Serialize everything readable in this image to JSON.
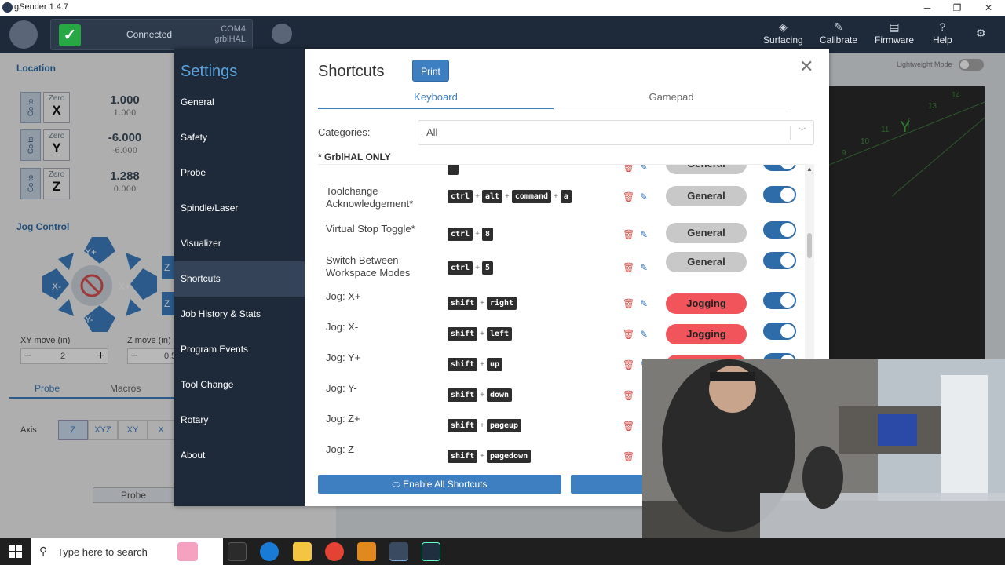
{
  "window": {
    "title": "gSender 1.4.7"
  },
  "topbar": {
    "connection": {
      "status": "Connected",
      "port": "COM4",
      "firmware": "grblHAL"
    },
    "nav": [
      {
        "label": "Surfacing",
        "icon": "surfacing-icon"
      },
      {
        "label": "Calibrate",
        "icon": "calibrate-icon"
      },
      {
        "label": "Firmware",
        "icon": "firmware-icon"
      },
      {
        "label": "Help",
        "icon": "help-icon"
      }
    ]
  },
  "location": {
    "title": "Location",
    "goto_label": "Go to",
    "zero_label": "Zero",
    "axes": [
      {
        "axis": "X",
        "value": "1.000",
        "machine": "1.000"
      },
      {
        "axis": "Y",
        "value": "-6.000",
        "machine": "-6.000"
      },
      {
        "axis": "Z",
        "value": "1.288",
        "machine": "0.000"
      }
    ]
  },
  "jog": {
    "title": "Jog Control",
    "xy_label": "XY move (in)",
    "xy_value": "2",
    "z_label": "Z move (in)",
    "z_value": "0.5",
    "labels": {
      "yplus": "Y+",
      "yminus": "Y-",
      "xplus": "X+",
      "xminus": "X-",
      "z": "Z"
    }
  },
  "bottom_tabs": {
    "probe": "Probe",
    "macros": "Macros"
  },
  "probe_panel": {
    "axis_label": "Axis",
    "axes": [
      "Z",
      "XYZ",
      "XY",
      "X"
    ],
    "probe_button": "Probe"
  },
  "lightweight": {
    "label": "Lightweight Mode"
  },
  "settings": {
    "title": "Settings",
    "menu": [
      "General",
      "Safety",
      "Probe",
      "Spindle/Laser",
      "Visualizer",
      "Shortcuts",
      "Job History & Stats",
      "Program Events",
      "Tool Change",
      "Rotary",
      "About"
    ],
    "active": "Shortcuts"
  },
  "shortcuts": {
    "title": "Shortcuts",
    "print_label": "Print",
    "tabs": {
      "keyboard": "Keyboard",
      "gamepad": "Gamepad"
    },
    "categories_label": "Categories:",
    "categories_value": "All",
    "grbl_note": "* GrblHAL ONLY",
    "rows": [
      {
        "name": "Toolchange Acknowledgement*",
        "keys": [
          "ctrl",
          "alt",
          "command",
          "a"
        ],
        "category": "General"
      },
      {
        "name": "Virtual Stop Toggle*",
        "keys": [
          "ctrl",
          "8"
        ],
        "category": "General"
      },
      {
        "name": "Switch Between Workspace Modes",
        "keys": [
          "ctrl",
          "5"
        ],
        "category": "General"
      },
      {
        "name": "Jog: X+",
        "keys": [
          "shift",
          "right"
        ],
        "category": "Jogging"
      },
      {
        "name": "Jog: X-",
        "keys": [
          "shift",
          "left"
        ],
        "category": "Jogging"
      },
      {
        "name": "Jog: Y+",
        "keys": [
          "shift",
          "up"
        ],
        "category": "Jogging"
      },
      {
        "name": "Jog: Y-",
        "keys": [
          "shift",
          "down"
        ],
        "category": ""
      },
      {
        "name": "Jog: Z+",
        "keys": [
          "shift",
          "pageup"
        ],
        "category": ""
      },
      {
        "name": "Jog: Z-",
        "keys": [
          "shift",
          "pagedown"
        ],
        "category": ""
      }
    ],
    "partial_row_category": "General",
    "enable_all": "Enable All Shortcuts"
  },
  "viz_ticks": [
    "14",
    "13",
    "11",
    "10",
    "9",
    "Y"
  ],
  "taskbar": {
    "search_placeholder": "Type here to search"
  }
}
